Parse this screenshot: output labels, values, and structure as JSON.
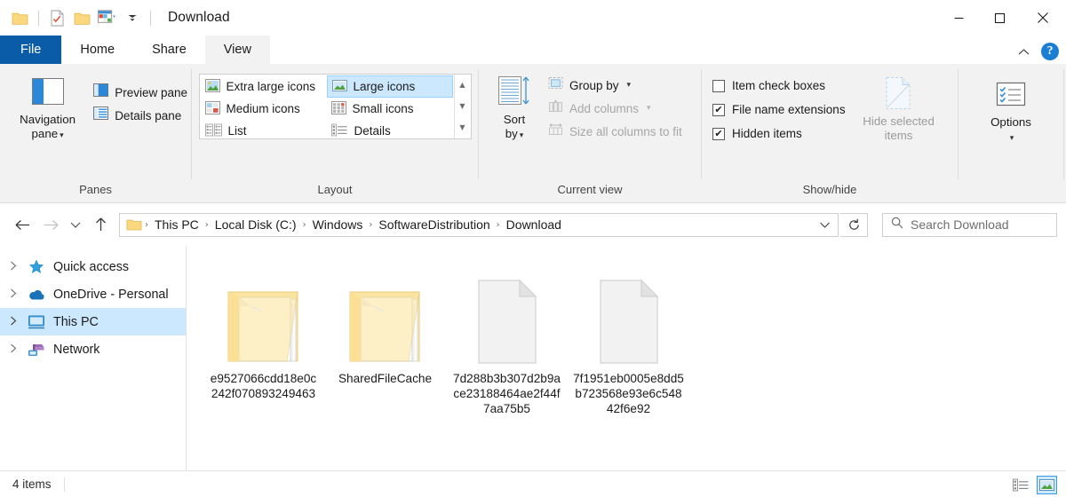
{
  "window": {
    "title": "Download",
    "quick_access_icons": [
      "folder-icon",
      "properties-checklist-icon",
      "new-folder-icon",
      "customize-qat-icon"
    ],
    "controls": {
      "minimize": "–",
      "maximize": "☐",
      "close": "✕"
    }
  },
  "tabs": [
    {
      "label": "File",
      "id": "tab-file"
    },
    {
      "label": "Home",
      "id": "tab-home"
    },
    {
      "label": "Share",
      "id": "tab-share"
    },
    {
      "label": "View",
      "id": "tab-view"
    }
  ],
  "tabs_right": {
    "collapse": "⌃",
    "help": "?"
  },
  "ribbon": {
    "groups": [
      {
        "label": "Panes",
        "big_button": {
          "label_line1": "Navigation",
          "label_line2": "pane",
          "icon": "navigation-pane-icon",
          "caret": "▾"
        },
        "small_buttons": [
          {
            "label": "Preview pane",
            "icon": "preview-pane-icon"
          },
          {
            "label": "Details pane",
            "icon": "details-pane-icon"
          }
        ]
      },
      {
        "label": "Layout",
        "gallery": [
          {
            "label": "Extra large icons",
            "icon": "extra-large-icons-icon",
            "selected": false
          },
          {
            "label": "Large icons",
            "icon": "large-icons-icon",
            "selected": true
          },
          {
            "label": "Medium icons",
            "icon": "medium-icons-icon",
            "selected": false
          },
          {
            "label": "Small icons",
            "icon": "small-icons-icon",
            "selected": false
          },
          {
            "label": "List",
            "icon": "list-view-icon",
            "selected": false
          },
          {
            "label": "Details",
            "icon": "details-view-icon",
            "selected": false
          }
        ],
        "scroll": {
          "up": "▲",
          "down": "▼",
          "more": "≡"
        }
      },
      {
        "label": "Current view",
        "big_button": {
          "label_line1": "Sort",
          "label_line2": "by",
          "icon": "sort-by-icon",
          "caret": "▾"
        },
        "small_buttons": [
          {
            "label": "Group by",
            "icon": "group-by-icon",
            "caret": "▾",
            "disabled": false
          },
          {
            "label": "Add columns",
            "icon": "add-columns-icon",
            "caret": "▾",
            "disabled": true
          },
          {
            "label": "Size all columns to fit",
            "icon": "size-columns-icon",
            "caret": "",
            "disabled": true
          }
        ]
      },
      {
        "label": "Show/hide",
        "checkboxes": [
          {
            "label": "Item check boxes",
            "checked": false
          },
          {
            "label": "File name extensions",
            "checked": true
          },
          {
            "label": "Hidden items",
            "checked": true
          }
        ],
        "big_button": {
          "label_line1": "Hide selected",
          "label_line2": "items",
          "icon": "hide-selected-items-icon",
          "disabled": true
        }
      },
      {
        "label": "",
        "big_button": {
          "label_line1": "Options",
          "label_line2": "",
          "icon": "options-icon",
          "caret": "▾"
        }
      }
    ]
  },
  "addressbar": {
    "back": "←",
    "forward": "→",
    "recent": "⌄",
    "up": "↑",
    "folder_icon": "folder-icon",
    "breadcrumbs": [
      "This PC",
      "Local Disk (C:)",
      "Windows",
      "SoftwareDistribution",
      "Download"
    ],
    "separator": "›",
    "dropdown": "⌄",
    "refresh": "↻",
    "search": {
      "placeholder": "Search Download",
      "icon": "search-icon"
    }
  },
  "sidebar": {
    "items": [
      {
        "label": "Quick access",
        "icon": "star-icon",
        "selected": false,
        "chevron": "›"
      },
      {
        "label": "OneDrive - Personal",
        "icon": "onedrive-cloud-icon",
        "selected": false,
        "chevron": "›"
      },
      {
        "label": "This PC",
        "icon": "this-pc-monitor-icon",
        "selected": true,
        "chevron": "›"
      },
      {
        "label": "Network",
        "icon": "network-icon",
        "selected": false,
        "chevron": "›"
      }
    ]
  },
  "files": [
    {
      "name": "e9527066cdd18e0c242f070893249463",
      "type": "folder"
    },
    {
      "name": "SharedFileCache",
      "type": "folder"
    },
    {
      "name": "7d288b3b307d2b9ace23188464ae2f44f7aa75b5",
      "type": "file"
    },
    {
      "name": "7f1951eb0005e8dd5b723568e93e6c54842f6e92",
      "type": "file"
    }
  ],
  "status": {
    "count": "4 items",
    "view_buttons": [
      {
        "name": "details-view-toggle",
        "selected": false
      },
      {
        "name": "large-icons-view-toggle",
        "selected": true
      }
    ]
  },
  "colors": {
    "accent": "#0b5ca8",
    "selection": "#cce8ff",
    "ribbon_bg": "#f2f2f2",
    "folder_yellow": "#fce49a"
  }
}
